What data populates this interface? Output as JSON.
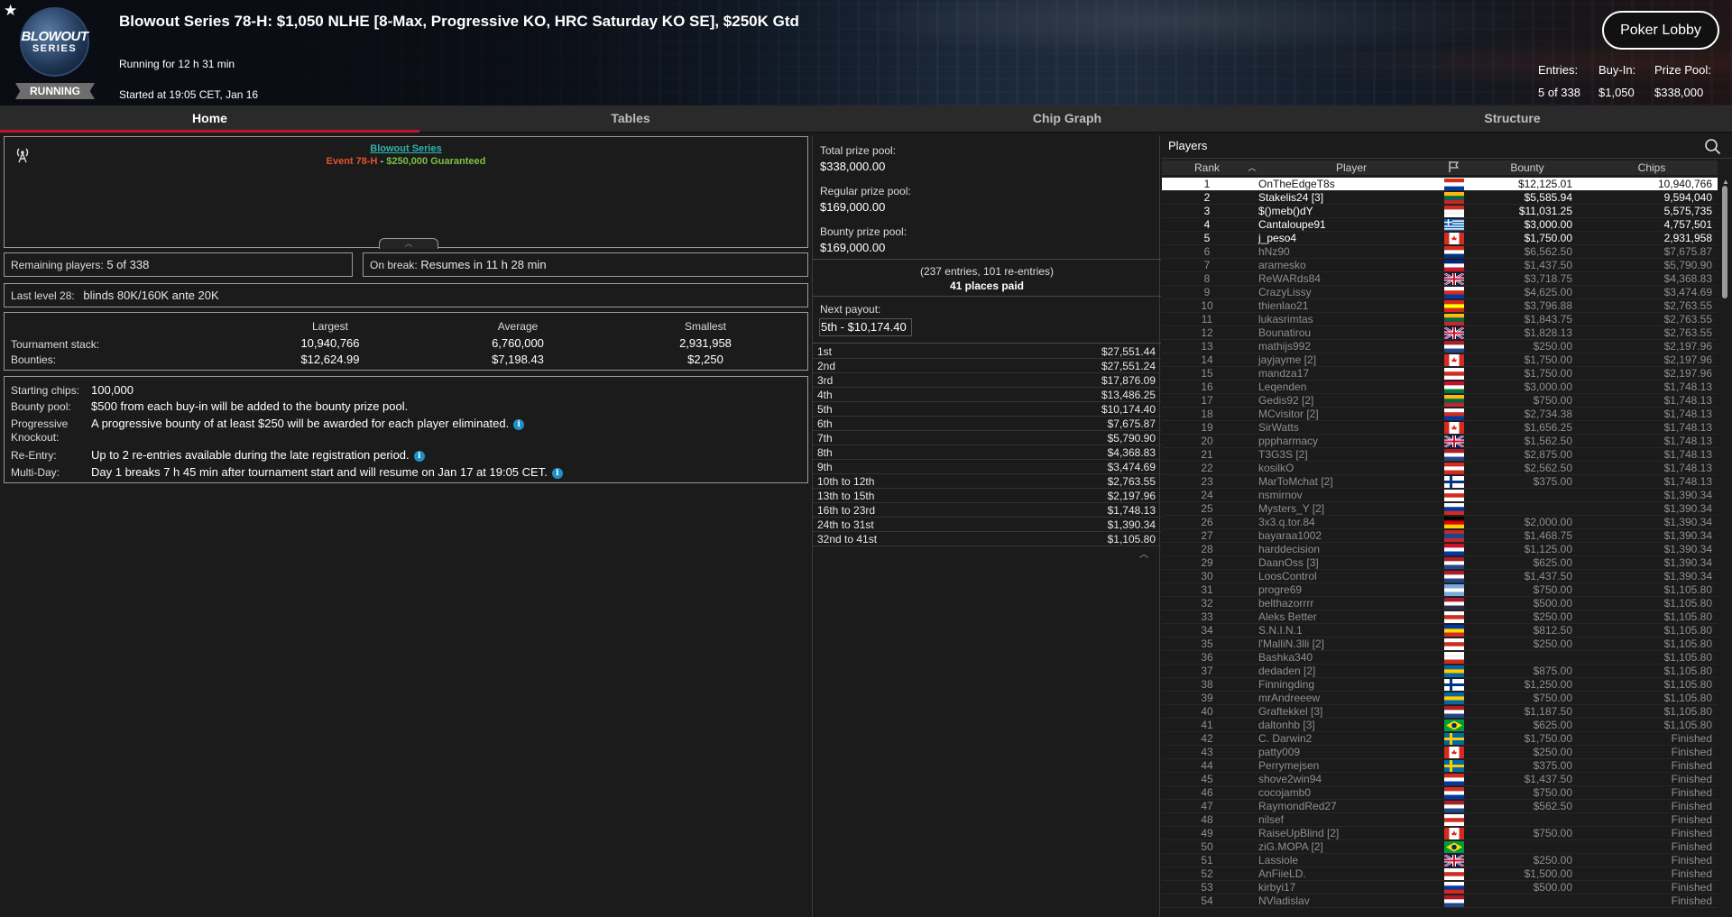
{
  "header": {
    "title": "Blowout Series 78-H: $1,050 NLHE [8-Max, Progressive KO, HRC Saturday KO SE], $250K Gtd",
    "running_for": "Running for 12 h 31 min",
    "started_at": "Started at 19:05 CET, Jan 16",
    "status_badge": "RUNNING",
    "logo_line1": "BLOWOUT",
    "logo_line2": "SERIES",
    "lobby_button": "Poker Lobby",
    "entries_label": "Entries:",
    "entries_value": "5 of 338",
    "buyin_label": "Buy-In:",
    "buyin_value": "$1,050",
    "prizepool_label": "Prize Pool:",
    "prizepool_value": "$338,000"
  },
  "tabs": [
    "Home",
    "Tables",
    "Chip Graph",
    "Structure"
  ],
  "event": {
    "series_link": "Blowout Series",
    "event_name": "Event 78-H",
    "separator": " - ",
    "guarantee": "$250,000 Guaranteed"
  },
  "remaining": {
    "label": "Remaining players:",
    "value": "5 of 338"
  },
  "on_break": {
    "label": "On break:",
    "value": "Resumes in 11 h 28 min"
  },
  "last_level": {
    "label": "Last level 28:",
    "value": "blinds 80K/160K ante 20K"
  },
  "stack_stats": {
    "headers": [
      "Largest",
      "Average",
      "Smallest"
    ],
    "stack_label": "Tournament stack:",
    "stack_values": [
      "10,940,766",
      "6,760,000",
      "2,931,958"
    ],
    "bounty_label": "Bounties:",
    "bounty_values": [
      "$12,624.99",
      "$7,198.43",
      "$2,250"
    ]
  },
  "info": {
    "starting_chips_label": "Starting chips:",
    "starting_chips": "100,000",
    "bounty_pool_label": "Bounty pool:",
    "bounty_pool": "$500 from each buy-in will be added to the bounty prize pool.",
    "pko_label_1": "Progressive",
    "pko_label_2": "Knockout:",
    "pko": "A progressive bounty of at least $250 will be awarded for each player eliminated.",
    "reentry_label": "Re-Entry:",
    "reentry": "Up to 2 re-entries available during the late registration period.",
    "multiday_label": "Multi-Day:",
    "multiday": "Day 1 breaks 7 h 45 min after tournament start and will resume on Jan 17 at 19:05 CET."
  },
  "prize": {
    "total_label": "Total prize pool:",
    "total": "$338,000.00",
    "regular_label": "Regular prize pool:",
    "regular": "$169,000.00",
    "bounty_label": "Bounty prize pool:",
    "bounty": "$169,000.00",
    "entries_note": "(237 entries, 101 re-entries)",
    "places_paid": "41 places paid",
    "next_payout_label": "Next payout:",
    "next_payout": "5th - $10,174.40",
    "payouts": [
      [
        "1st",
        "$27,551.44"
      ],
      [
        "2nd",
        "$27,551.24"
      ],
      [
        "3rd",
        "$17,876.09"
      ],
      [
        "4th",
        "$13,486.25"
      ],
      [
        "5th",
        "$10,174.40"
      ],
      [
        "6th",
        "$7,675.87"
      ],
      [
        "7th",
        "$5,790.90"
      ],
      [
        "8th",
        "$4,368.83"
      ],
      [
        "9th",
        "$3,474.69"
      ],
      [
        "10th to 12th",
        "$2,763.55"
      ],
      [
        "13th to 15th",
        "$2,197.96"
      ],
      [
        "16th to 23rd",
        "$1,748.13"
      ],
      [
        "24th to 31st",
        "$1,390.34"
      ],
      [
        "32nd to 41st",
        "$1,105.80"
      ]
    ]
  },
  "players": {
    "title": "Players",
    "columns": [
      "Rank",
      "Player",
      "Bounty",
      "Chips"
    ],
    "rows": [
      [
        "1",
        "OnTheEdgeT8s",
        "$12,125.01",
        "10,940,766"
      ],
      [
        "2",
        "Stakelis24 [3]",
        "$5,585.94",
        "9,594,040"
      ],
      [
        "3",
        "$()meb()dY",
        "$11,031.25",
        "5,575,735"
      ],
      [
        "4",
        "Cantaloupe91",
        "$3,000.00",
        "4,757,501"
      ],
      [
        "5",
        "j_peso4",
        "$1,750.00",
        "2,931,958"
      ],
      [
        "6",
        "hNz90",
        "$6,562.50",
        "$7,675.87"
      ],
      [
        "7",
        "aramesko",
        "$1,437.50",
        "$5,790.90"
      ],
      [
        "8",
        "ReWARds84",
        "$3,718.75",
        "$4,368.83"
      ],
      [
        "9",
        "CrazyLissy",
        "$4,625.00",
        "$3,474.69"
      ],
      [
        "10",
        "thienlao21",
        "$3,796.88",
        "$2,763.55"
      ],
      [
        "11",
        "lukasrimtas",
        "$1,843.75",
        "$2,763.55"
      ],
      [
        "12",
        "Bounatirou",
        "$1,828.13",
        "$2,763.55"
      ],
      [
        "13",
        "mathijs992",
        "$250.00",
        "$2,197.96"
      ],
      [
        "14",
        "jayjayme [2]",
        "$1,750.00",
        "$2,197.96"
      ],
      [
        "15",
        "mandza17",
        "$1,750.00",
        "$2,197.96"
      ],
      [
        "16",
        "Leqenden",
        "$3,000.00",
        "$1,748.13"
      ],
      [
        "17",
        "Gedis92 [2]",
        "$750.00",
        "$1,748.13"
      ],
      [
        "18",
        "MCvisitor [2]",
        "$2,734.38",
        "$1,748.13"
      ],
      [
        "19",
        "SirWatts",
        "$1,656.25",
        "$1,748.13"
      ],
      [
        "20",
        "pppharmacy",
        "$1,562.50",
        "$1,748.13"
      ],
      [
        "21",
        "T3G3S [2]",
        "$2,875.00",
        "$1,748.13"
      ],
      [
        "22",
        "kosilkO",
        "$2,562.50",
        "$1,748.13"
      ],
      [
        "23",
        "MarToMchat [2]",
        "$375.00",
        "$1,748.13"
      ],
      [
        "24",
        "nsmirnov",
        "",
        "$1,390.34"
      ],
      [
        "25",
        "Mysters_Y [2]",
        "",
        "$1,390.34"
      ],
      [
        "26",
        "3x3.q.tor.84",
        "$2,000.00",
        "$1,390.34"
      ],
      [
        "27",
        "bayaraa1002",
        "$1,468.75",
        "$1,390.34"
      ],
      [
        "28",
        "harddecision",
        "$1,125.00",
        "$1,390.34"
      ],
      [
        "29",
        "DaanOss [3]",
        "$625.00",
        "$1,390.34"
      ],
      [
        "30",
        "LoosControl",
        "$1,437.50",
        "$1,390.34"
      ],
      [
        "31",
        "progre69",
        "$750.00",
        "$1,105.80"
      ],
      [
        "32",
        "belthazorrrr",
        "$500.00",
        "$1,105.80"
      ],
      [
        "33",
        "Aleks Better",
        "$250.00",
        "$1,105.80"
      ],
      [
        "34",
        "S.N.I.N.1",
        "$812.50",
        "$1,105.80"
      ],
      [
        "35",
        "l'MalliN.3lli [2]",
        "$250.00",
        "$1,105.80"
      ],
      [
        "36",
        "Bashka340",
        "",
        "$1,105.80"
      ],
      [
        "37",
        "dedaden [2]",
        "$875.00",
        "$1,105.80"
      ],
      [
        "38",
        "Finningding",
        "$1,250.00",
        "$1,105.80"
      ],
      [
        "39",
        "mrAndreeew",
        "$750.00",
        "$1,105.80"
      ],
      [
        "40",
        "Graftekkel [3]",
        "$1,187.50",
        "$1,105.80"
      ],
      [
        "41",
        "daltonhb [3]",
        "$625.00",
        "$1,105.80"
      ],
      [
        "42",
        "C. Darwin2",
        "$1,750.00",
        "Finished"
      ],
      [
        "43",
        "patty009",
        "$250.00",
        "Finished"
      ],
      [
        "44",
        "Perrymejsen",
        "$375.00",
        "Finished"
      ],
      [
        "45",
        "shove2win94",
        "$1,437.50",
        "Finished"
      ],
      [
        "46",
        "cocojamb0",
        "$750.00",
        "Finished"
      ],
      [
        "47",
        "RaymondRed27",
        "$562.50",
        "Finished"
      ],
      [
        "48",
        "nilsef",
        "",
        "Finished"
      ],
      [
        "49",
        "RaiseUpBlind [2]",
        "$750.00",
        "Finished"
      ],
      [
        "50",
        "ziG.MOPA [2]",
        "",
        "Finished"
      ],
      [
        "51",
        "Lassiole",
        "$250.00",
        "Finished"
      ],
      [
        "52",
        "AnFiieLD.",
        "$1,500.00",
        "Finished"
      ],
      [
        "53",
        "kirbyi17",
        "$500.00",
        "Finished"
      ],
      [
        "54",
        "NVladislav",
        "",
        "Finished"
      ]
    ]
  }
}
